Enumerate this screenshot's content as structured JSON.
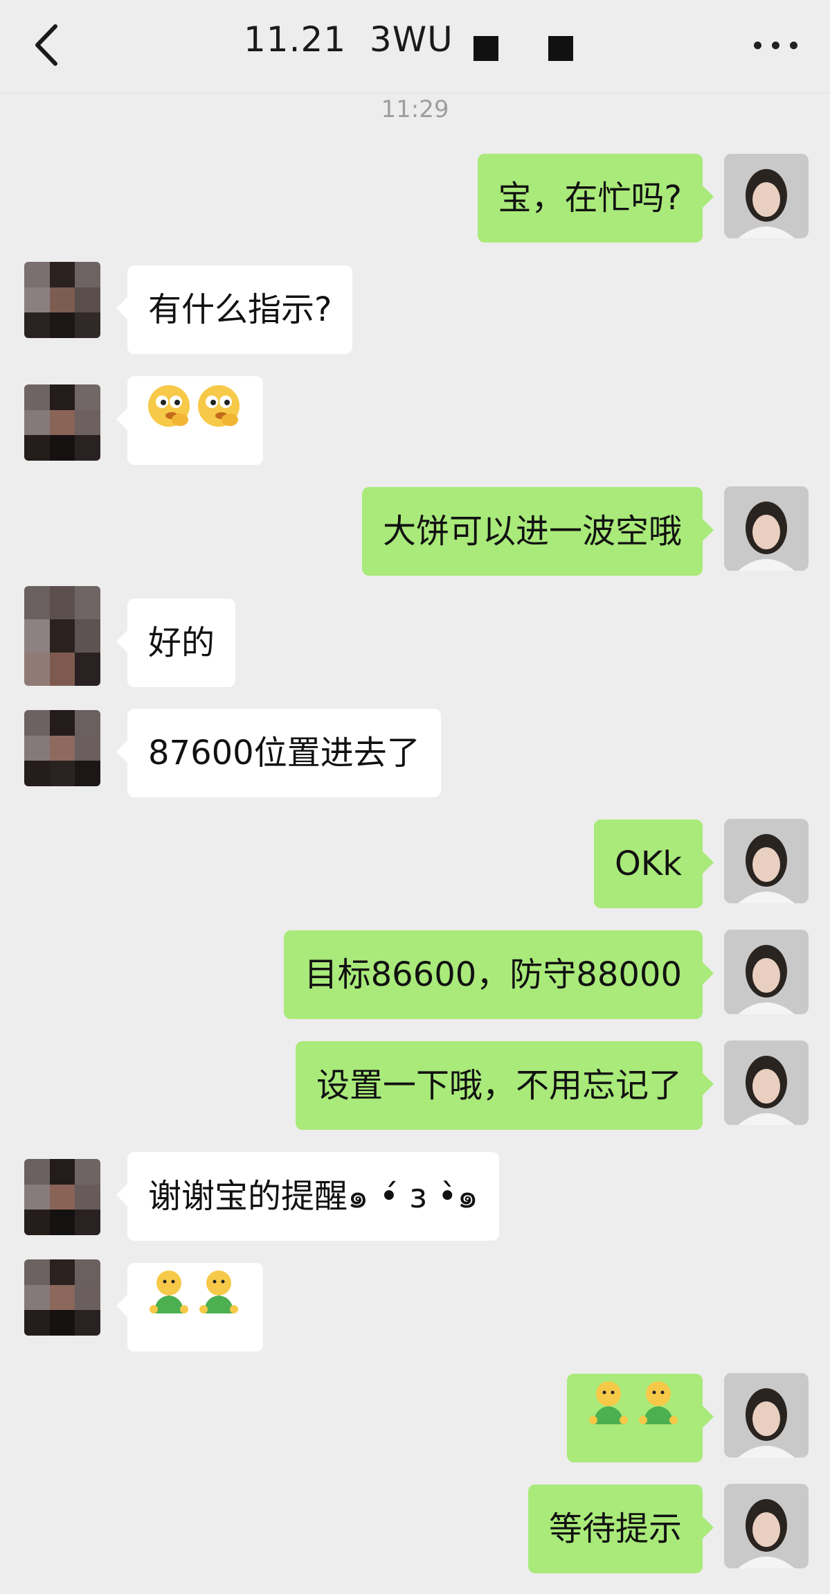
{
  "header": {
    "title": "11.21  3WU"
  },
  "timestamp": "11:29",
  "messages": [
    {
      "side": "me",
      "text": "宝，在忙吗?"
    },
    {
      "side": "other",
      "text": "有什么指示?"
    },
    {
      "side": "other",
      "sticker": "thinking-face-sticker"
    },
    {
      "side": "me",
      "text": "大饼可以进一波空哦"
    },
    {
      "side": "other",
      "text": "好的"
    },
    {
      "side": "other",
      "text": "87600位置进去了"
    },
    {
      "side": "me",
      "text": "OKk"
    },
    {
      "side": "me",
      "text": "目标86600，防守88000"
    },
    {
      "side": "me",
      "text": "设置一下哦，不用忘记了"
    },
    {
      "side": "other",
      "text": "谢谢宝的提醒๑ •́ з •̀๑"
    },
    {
      "side": "other",
      "sticker": "green-shirt-emoji-sticker"
    },
    {
      "side": "me",
      "sticker": "green-shirt-emoji-sticker"
    },
    {
      "side": "me",
      "text": "等待提示"
    }
  ],
  "colors": {
    "background": "#ededed",
    "bubble_me": "#a9ea7a",
    "bubble_other": "#ffffff"
  }
}
